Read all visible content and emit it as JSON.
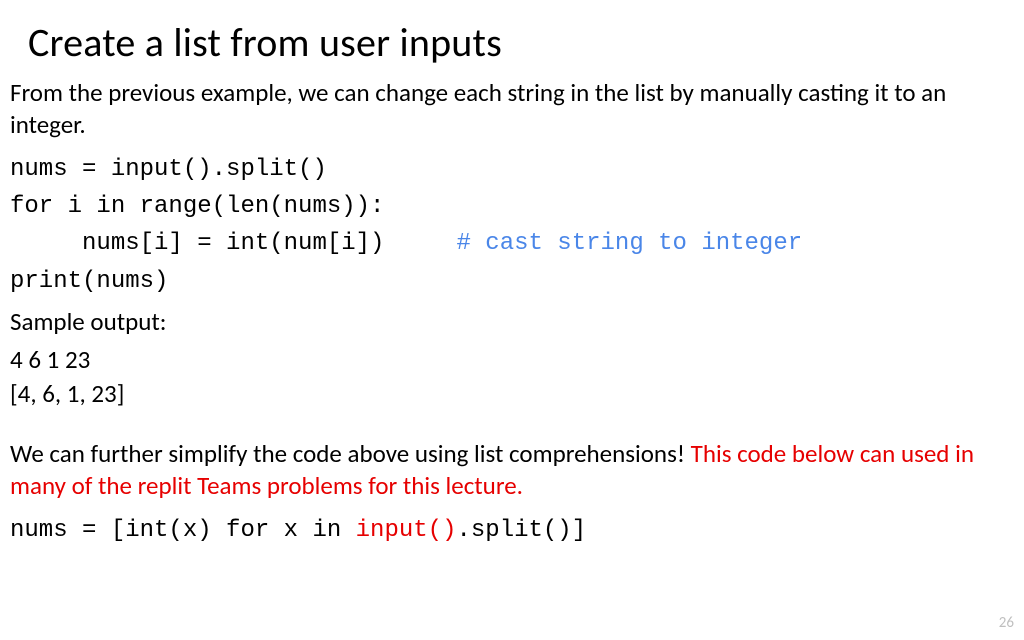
{
  "title": "Create a list from user inputs",
  "intro": "From the previous example, we can change each string in the list by manually casting it to an integer.",
  "code": {
    "l1": "nums = input().split()",
    "l2": "for i in range(len(nums)):",
    "l3_code": "     nums[i] = int(num[i])     ",
    "l3_comment": "# cast string to integer",
    "l4": "print(nums)"
  },
  "sample_label": "Sample output:",
  "sample": {
    "in": "4 6 1 23",
    "out": "[4, 6, 1, 23]"
  },
  "footer": {
    "black": "We can further simplify the code above using list comprehensions! ",
    "red": "This code below can used in many of the replit Teams problems for this lecture."
  },
  "code2": {
    "pre": "nums = [int(x) for x in ",
    "hl": "input()",
    "post": ".split()]"
  },
  "page_number": "26"
}
